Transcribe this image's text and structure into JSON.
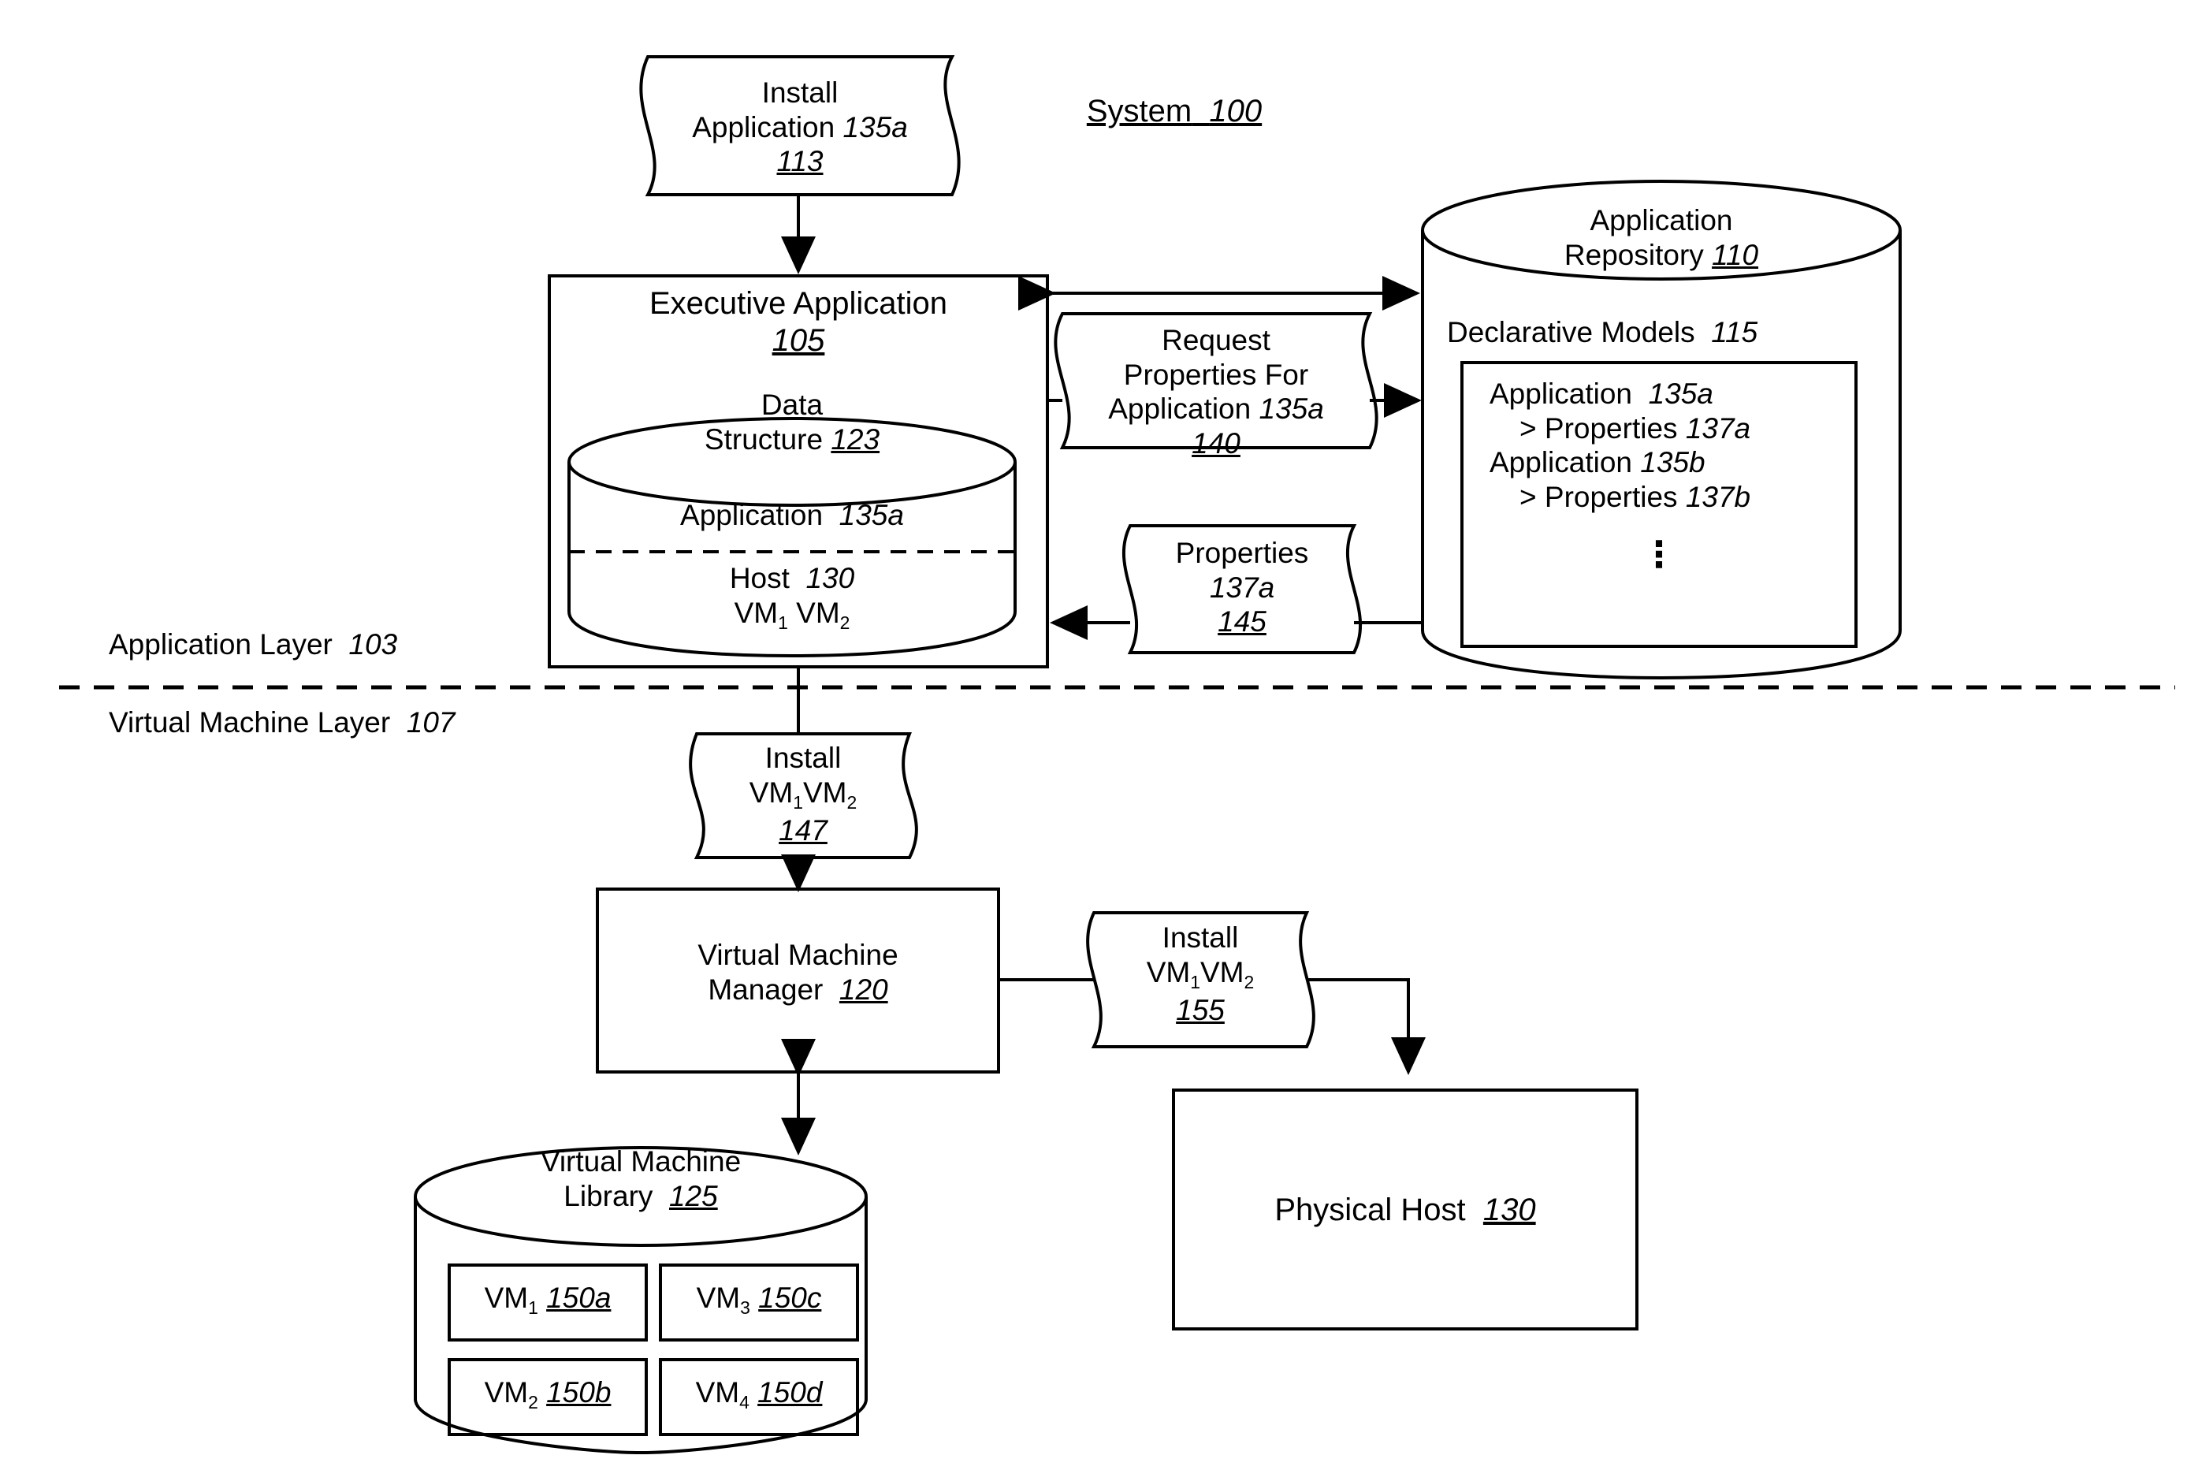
{
  "figure": {
    "title_label": "System",
    "title_ref": "100"
  },
  "layers": {
    "application": {
      "label": "Application Layer",
      "ref": "103"
    },
    "virtual_machine": {
      "label": "Virtual Machine Layer",
      "ref": "107"
    }
  },
  "nodes": {
    "install_app": {
      "line1": "Install",
      "line2_label": "Application",
      "line2_ref": "135a",
      "ref": "113"
    },
    "executive_application": {
      "label": "Executive Application",
      "ref": "105",
      "data_structure": {
        "line1": "Data",
        "line2_label": "Structure",
        "line2_ref": "123"
      },
      "application_label": "Application",
      "application_ref": "135a",
      "host_label": "Host",
      "host_ref": "130",
      "vm1": "VM",
      "vm1_sub": "1",
      "vm2": "VM",
      "vm2_sub": "2"
    },
    "request_properties": {
      "line1": "Request",
      "line2": "Properties For",
      "line3_label": "Application",
      "line3_ref": "135a",
      "ref": "140"
    },
    "properties_response": {
      "line1": "Properties",
      "line2": "137a",
      "ref": "145"
    },
    "application_repository": {
      "line1": "Application",
      "line2_label": "Repository",
      "line2_ref": "110",
      "declarative_models_label": "Declarative Models",
      "declarative_models_ref": "115",
      "models": [
        {
          "app_label": "Application",
          "app_ref": "135a",
          "prop_label": "> Properties",
          "prop_ref": "137a"
        },
        {
          "app_label": "Application",
          "app_ref": "135b",
          "prop_label": "> Properties",
          "prop_ref": "137b"
        }
      ],
      "ellipsis": "⋮"
    },
    "install_vm_147": {
      "line1": "Install",
      "vm1": "VM",
      "vm1_sub": "1",
      "vm2": "VM",
      "vm2_sub": "2",
      "ref": "147"
    },
    "vm_manager": {
      "line1": "Virtual Machine",
      "line2_label": "Manager",
      "line2_ref": "120"
    },
    "install_vm_155": {
      "line1": "Install",
      "vm1": "VM",
      "vm1_sub": "1",
      "vm2": "VM",
      "vm2_sub": "2",
      "ref": "155"
    },
    "vm_library": {
      "line1": "Virtual Machine",
      "line2_label": "Library",
      "line2_ref": "125",
      "items": [
        {
          "name": "VM",
          "sub": "1",
          "ref": "150a"
        },
        {
          "name": "VM",
          "sub": "3",
          "ref": "150c"
        },
        {
          "name": "VM",
          "sub": "2",
          "ref": "150b"
        },
        {
          "name": "VM",
          "sub": "4",
          "ref": "150d"
        }
      ]
    },
    "physical_host": {
      "label": "Physical Host",
      "ref": "130"
    }
  },
  "colors": {
    "stroke": "#000000",
    "background": "#ffffff"
  }
}
